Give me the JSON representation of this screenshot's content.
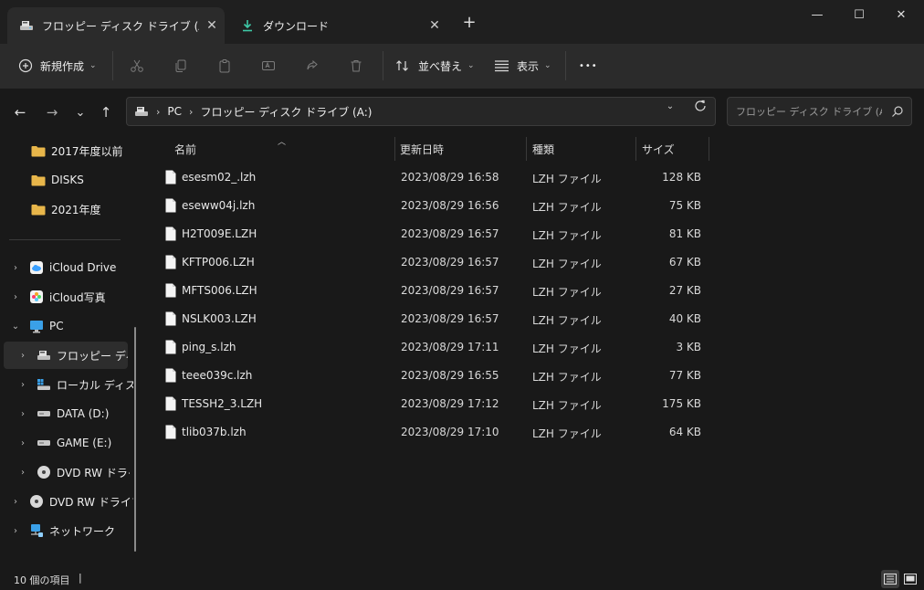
{
  "tabs": [
    {
      "label": "フロッピー ディスク ドライブ (A:)",
      "icon": "floppy-drive-icon",
      "close": "✕"
    },
    {
      "label": "ダウンロード",
      "icon": "download-icon",
      "close": "✕"
    }
  ],
  "new_tab": "+",
  "window_controls": {
    "minimize": "—",
    "maximize": "☐",
    "close": "✕"
  },
  "toolbar": {
    "new_label": "新規作成",
    "sort_label": "並べ替え",
    "view_label": "表示",
    "more_label": "•••"
  },
  "nav": {
    "back": "←",
    "forward": "→",
    "recent": "⌄",
    "up": "↑"
  },
  "address": {
    "crumbs": [
      "PC",
      "フロッピー ディスク ドライブ (A:)"
    ]
  },
  "search": {
    "placeholder": "フロッピー ディスク ドライブ (A:)..."
  },
  "sidebar": {
    "quick": [
      {
        "label": "2017年度以前",
        "icon": "folder-icon"
      },
      {
        "label": "DISKS",
        "icon": "folder-icon"
      },
      {
        "label": "2021年度",
        "icon": "folder-icon"
      }
    ],
    "tree": [
      {
        "label": "iCloud Drive",
        "icon": "icloud-drive-icon"
      },
      {
        "label": "iCloud写真",
        "icon": "icloud-photos-icon"
      },
      {
        "label": "PC",
        "icon": "pc-icon"
      },
      {
        "label": "フロッピー ディスク",
        "icon": "floppy-drive-icon"
      },
      {
        "label": "ローカル ディスク",
        "icon": "local-disk-icon"
      },
      {
        "label": "DATA (D:)",
        "icon": "drive-icon"
      },
      {
        "label": "GAME (E:)",
        "icon": "drive-icon"
      },
      {
        "label": "DVD RW ドライブ",
        "icon": "dvd-drive-icon"
      },
      {
        "label": "DVD RW ドライブ",
        "icon": "dvd-drive-icon"
      },
      {
        "label": "ネットワーク",
        "icon": "network-icon"
      }
    ]
  },
  "columns": {
    "name": "名前",
    "date": "更新日時",
    "type": "種類",
    "size": "サイズ"
  },
  "files": [
    {
      "name": "esesm02_.lzh",
      "date": "2023/08/29 16:58",
      "type": "LZH ファイル",
      "size": "128 KB"
    },
    {
      "name": "eseww04j.lzh",
      "date": "2023/08/29 16:56",
      "type": "LZH ファイル",
      "size": "75 KB"
    },
    {
      "name": "H2T009E.LZH",
      "date": "2023/08/29 16:57",
      "type": "LZH ファイル",
      "size": "81 KB"
    },
    {
      "name": "KFTP006.LZH",
      "date": "2023/08/29 16:57",
      "type": "LZH ファイル",
      "size": "67 KB"
    },
    {
      "name": "MFTS006.LZH",
      "date": "2023/08/29 16:57",
      "type": "LZH ファイル",
      "size": "27 KB"
    },
    {
      "name": "NSLK003.LZH",
      "date": "2023/08/29 16:57",
      "type": "LZH ファイル",
      "size": "40 KB"
    },
    {
      "name": "ping_s.lzh",
      "date": "2023/08/29 17:11",
      "type": "LZH ファイル",
      "size": "3 KB"
    },
    {
      "name": "teee039c.lzh",
      "date": "2023/08/29 16:55",
      "type": "LZH ファイル",
      "size": "77 KB"
    },
    {
      "name": "TESSH2_3.LZH",
      "date": "2023/08/29 17:12",
      "type": "LZH ファイル",
      "size": "175 KB"
    },
    {
      "name": "tlib037b.lzh",
      "date": "2023/08/29 17:10",
      "type": "LZH ファイル",
      "size": "64 KB"
    }
  ],
  "status": {
    "count": "10 個の項目"
  },
  "colors": {
    "background": "#191919",
    "toolbar": "#2b2b2b",
    "folder": "#e8b64a",
    "accent": "#4cc2ff"
  }
}
